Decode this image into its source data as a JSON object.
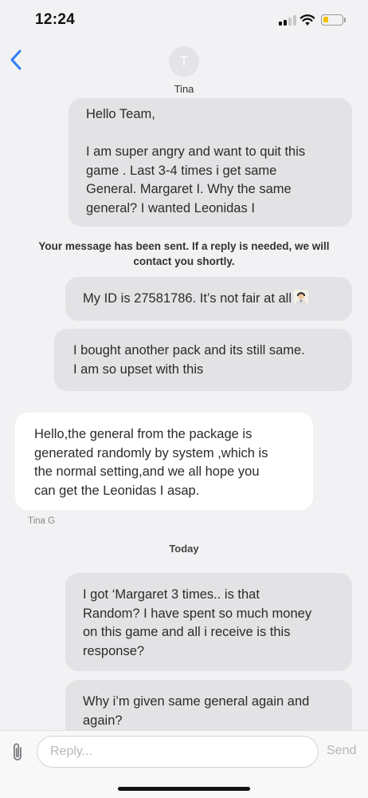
{
  "status_bar": {
    "time": "12:24"
  },
  "header": {
    "contact_initial": "T",
    "contact_name": "Tina"
  },
  "messages": [
    {
      "id": "m1",
      "direction": "outgoing",
      "lines": [
        "Hello Team,",
        "",
        "I am super angry and want to quit this",
        "game . Last 3-4 times i get same",
        "General. Margaret I. Why the same",
        "general? I wanted Leonidas I"
      ]
    },
    {
      "id": "m2",
      "direction": "outgoing",
      "lines": [
        "My ID is 27581786. It’s not fair at all"
      ],
      "emoji": "person-emoji"
    },
    {
      "id": "m3",
      "direction": "outgoing",
      "lines": [
        "I bought another pack and its still same.",
        "I am so upset with this"
      ]
    },
    {
      "id": "m4",
      "direction": "incoming",
      "lines": [
        "Hello,the general from the package is",
        "generated randomly by system ,which is",
        "the normal setting,and we all hope you",
        "can get the Leonidas I asap."
      ]
    },
    {
      "id": "m5",
      "direction": "outgoing",
      "lines": [
        "I got ‘Margaret 3 times.. is that",
        "Random? I have spent so much money",
        "on this game and all i receive is this",
        "response?"
      ]
    },
    {
      "id": "m6",
      "direction": "outgoing",
      "lines": [
        "Why i’m given same general again and",
        "again?"
      ]
    }
  ],
  "system_note": {
    "line1": "Your message has been sent. If a reply is needed, we will",
    "line2": "contact you shortly."
  },
  "sender_label": "Tina G",
  "day_separator": "Today",
  "composer": {
    "placeholder": "Reply...",
    "send_label": "Send"
  },
  "colors": {
    "accent": "#2f7cf6",
    "outgoing_bubble": "#e3e3e6",
    "incoming_bubble": "#ffffff",
    "background": "#f2f2f4"
  }
}
